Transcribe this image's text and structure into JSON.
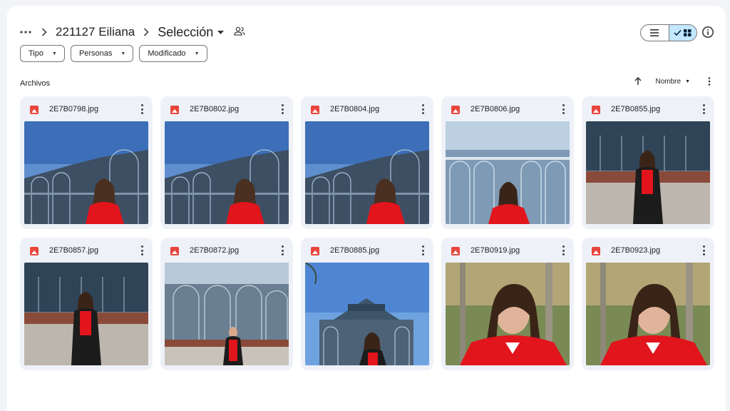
{
  "breadcrumb": {
    "more_icon": "more-horizontal-icon",
    "items": [
      "221127 Eiliana",
      "Selección"
    ]
  },
  "filters": [
    "Tipo",
    "Personas",
    "Modificado"
  ],
  "section": {
    "label": "Archivos"
  },
  "sort": {
    "label": "Nombre",
    "direction_icon": "arrow-up-icon"
  },
  "view": {
    "active": "grid"
  },
  "files": [
    {
      "name": "2E7B0798.jpg",
      "scene": "palace-sky"
    },
    {
      "name": "2E7B0802.jpg",
      "scene": "palace-sky"
    },
    {
      "name": "2E7B0804.jpg",
      "scene": "palace-sky"
    },
    {
      "name": "2E7B0806.jpg",
      "scene": "palace-front"
    },
    {
      "name": "2E7B0855.jpg",
      "scene": "palace-full"
    },
    {
      "name": "2E7B0857.jpg",
      "scene": "palace-full"
    },
    {
      "name": "2E7B0872.jpg",
      "scene": "palace-far"
    },
    {
      "name": "2E7B0885.jpg",
      "scene": "dome-sky"
    },
    {
      "name": "2E7B0919.jpg",
      "scene": "park-close"
    },
    {
      "name": "2E7B0923.jpg",
      "scene": "park-close"
    }
  ],
  "colors": {
    "accent": "#c2e7ff",
    "card_bg": "#eef1f7",
    "image_icon": "#e8453c",
    "outfit_red": "#e2141c"
  }
}
